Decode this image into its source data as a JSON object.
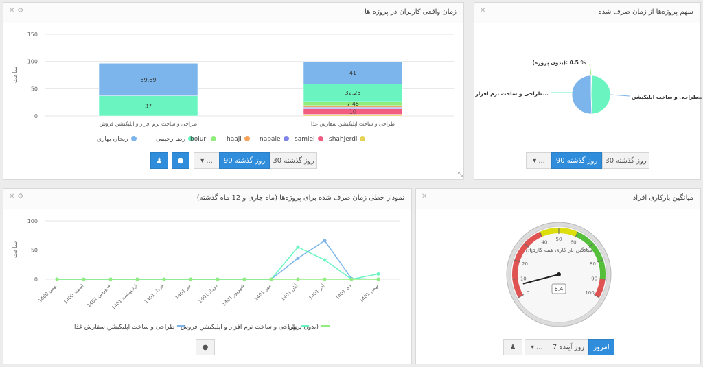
{
  "panels": {
    "stacked": {
      "title": "زمان واقعی کاربران در پروژه ها",
      "ylabel": "ساعت",
      "yticks": [
        "150",
        "100",
        "50",
        "0"
      ],
      "categories": [
        "طراحی و ساخت نرم افزار و اپلیکیشن فروش",
        "طراحی و ساخت اپلیکیشن سفارش غذا"
      ],
      "legend": [
        "ریحان بهاری",
        "رضا رحیمی",
        "boluri",
        "haaji",
        "nabaie",
        "samiei",
        "shahjerdi"
      ],
      "legend_colors": [
        "#7cb5ec",
        "#6af5c0",
        "#90ed7d",
        "#f7a35c",
        "#8085e9",
        "#f15c80",
        "#e4d354"
      ],
      "buttons": {
        "days30": "30 روز گذشته",
        "days90": "90 روز گذشته",
        "more": "...",
        "caret": "▾"
      }
    },
    "pie": {
      "title": "سهم پروژه‌ها از زمان صرف شده",
      "labels": [
        "(بدون پروژه): 0.5 %",
        "طراحی و ساخت نرم افزار و اپلی...",
        "طراحی و ساخت اپلیکیشن..."
      ],
      "buttons": {
        "days30": "30 روز گذشته",
        "days90": "90 روز گذشته",
        "more": "...",
        "caret": "▾"
      }
    },
    "line": {
      "title": "نمودار خطی زمان صرف شده برای پروژه‌ها (ماه جاری و 12 ماه گذشته)",
      "ylabel": "ساعت",
      "yticks": [
        "100",
        "50",
        "0"
      ],
      "xticks": [
        "بهمن 1400",
        "اسفند 1400",
        "فروردین 1401",
        "اردیبهشت 1401",
        "خرداد 1401",
        "تیر 1401",
        "مرداد 1401",
        "شهریور 1401",
        "مهر 1401",
        "آبان 1401",
        "آذر 1401",
        "دی 1401",
        "بهمن 1401"
      ],
      "legend": [
        "طراحی و ساخت اپلیکیشن سفارش غذا",
        "طراحی و ساخت نرم افزار و اپلیکیشن فروش",
        "(بدون پروژه)"
      ]
    },
    "gauge": {
      "title": "میانگین بارکاری افراد",
      "label": "میانگین بار کاری همه کاربران",
      "ticks": [
        "0",
        "10",
        "20",
        "30",
        "40",
        "50",
        "60",
        "70",
        "80",
        "90",
        "100"
      ],
      "value_text": "6.4",
      "buttons": {
        "today": "امروز",
        "days7": "7 روز آینده",
        "more": "...",
        "caret": "▾"
      }
    }
  },
  "chart_data": [
    {
      "type": "bar",
      "title": "زمان واقعی کاربران در پروژه ها",
      "ylabel": "ساعت",
      "ylim": [
        0,
        150
      ],
      "categories": [
        "طراحی و ساخت نرم افزار و اپلیکیشن فروش",
        "طراحی و ساخت اپلیکیشن سفارش غذا"
      ],
      "series": [
        {
          "name": "ریحان بهاری",
          "values": [
            59.69,
            41
          ]
        },
        {
          "name": "رضا رحیمی",
          "values": [
            37,
            32.25
          ]
        },
        {
          "name": "boluri",
          "values": [
            0,
            7.45
          ]
        },
        {
          "name": "haaji",
          "values": [
            0,
            3
          ]
        },
        {
          "name": "nabaie",
          "values": [
            0,
            3
          ]
        },
        {
          "name": "samiei",
          "values": [
            0,
            10
          ]
        },
        {
          "name": "shahjerdi",
          "values": [
            0,
            3
          ]
        }
      ],
      "stacked": true,
      "legend": "bottom"
    },
    {
      "type": "pie",
      "title": "سهم پروژه‌ها از زمان صرف شده",
      "labels": [
        "(بدون پروژه)",
        "طراحی و ساخت نرم افزار و اپلی...",
        "طراحی و ساخت اپلیکیشن..."
      ],
      "values": [
        0.5,
        49,
        50.5
      ]
    },
    {
      "type": "line",
      "title": "نمودار خطی زمان صرف شده برای پروژه‌ها (ماه جاری و 12 ماه گذشته)",
      "ylabel": "ساعت",
      "ylim": [
        0,
        100
      ],
      "x": [
        "بهمن 1400",
        "اسفند 1400",
        "فروردین 1401",
        "اردیبهشت 1401",
        "خرداد 1401",
        "تیر 1401",
        "مرداد 1401",
        "شهریور 1401",
        "مهر 1401",
        "آبان 1401",
        "آذر 1401",
        "دی 1401",
        "بهمن 1401"
      ],
      "series": [
        {
          "name": "طراحی و ساخت اپلیکیشن سفارش غذا",
          "values": [
            0,
            0,
            0,
            0,
            0,
            0,
            0,
            0,
            0,
            36,
            66,
            1,
            0
          ]
        },
        {
          "name": "طراحی و ساخت نرم افزار و اپلیکیشن فروش",
          "values": [
            0,
            0,
            0,
            0,
            0,
            0,
            0,
            0,
            0,
            55,
            33,
            0,
            9
          ]
        },
        {
          "name": "(بدون پروژه)",
          "values": [
            0,
            0,
            0,
            0,
            0,
            0,
            0,
            0,
            0,
            0,
            0,
            0,
            0
          ]
        }
      ],
      "legend": "bottom"
    },
    {
      "type": "gauge",
      "title": "میانگین بارکاری افراد",
      "label": "میانگین بار کاری همه کاربران",
      "value": 6.4,
      "range": [
        0,
        100
      ]
    }
  ]
}
